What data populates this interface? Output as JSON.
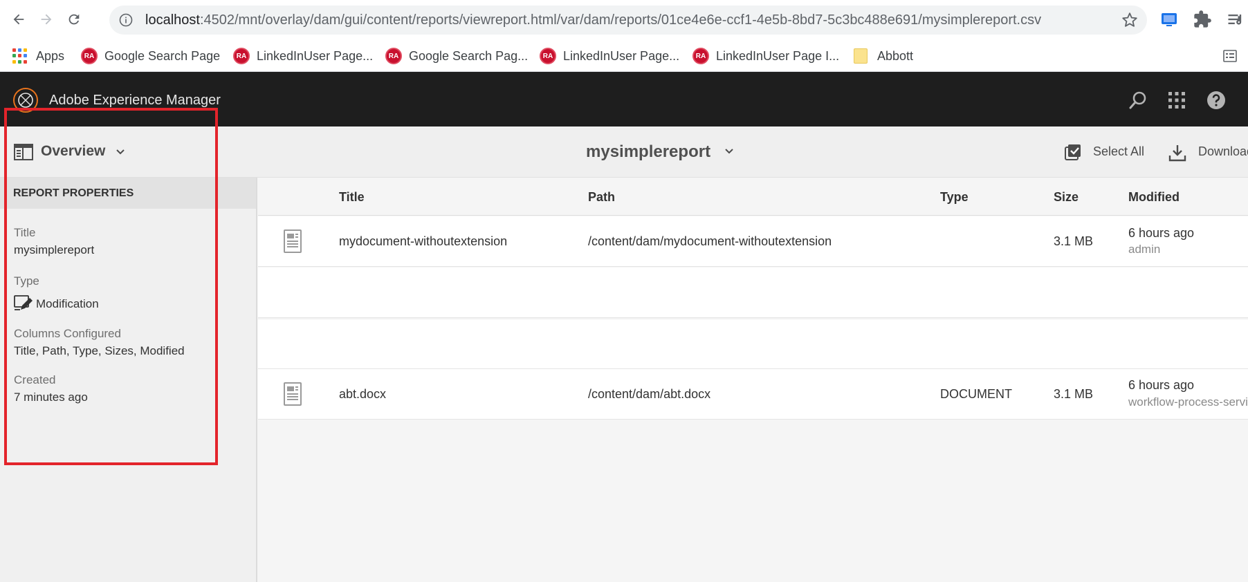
{
  "browser": {
    "url_host": "localhost",
    "url_path": ":4502/mnt/overlay/dam/gui/content/reports/viewreport.html/var/dam/reports/01ce4e6e-ccf1-4e5b-8bd7-5c3bc488e691/mysimplereport.csv",
    "bookmarks": [
      {
        "label": "Apps",
        "icon": "apps-grid-icon"
      },
      {
        "label": "Google Search Page",
        "icon": "ra-icon"
      },
      {
        "label": "LinkedInUser Page...",
        "icon": "ra-icon"
      },
      {
        "label": "Google Search Pag...",
        "icon": "ra-icon"
      },
      {
        "label": "LinkedInUser Page...",
        "icon": "ra-icon"
      },
      {
        "label": "LinkedInUser Page I...",
        "icon": "ra-icon"
      },
      {
        "label": "Abbott",
        "icon": "folder-icon"
      }
    ],
    "ra_badge": "RA"
  },
  "shell": {
    "title": "Adobe Experience Manager",
    "icons": [
      "search-icon",
      "apps-grid-icon",
      "help-icon"
    ]
  },
  "action_bar": {
    "rail_label": "Overview",
    "report_title": "mysimplereport",
    "select_all_label": "Select All",
    "download_label": "Download"
  },
  "rail": {
    "section_title": "REPORT PROPERTIES",
    "properties": [
      {
        "label": "Title",
        "value": "mysimplereport"
      },
      {
        "label": "Type",
        "value": "Modification",
        "icon": "edit-document-icon"
      },
      {
        "label": "Columns Configured",
        "value": "Title, Path, Type, Sizes, Modified"
      },
      {
        "label": "Created",
        "value": "7 minutes ago"
      }
    ]
  },
  "table": {
    "columns": [
      "Title",
      "Path",
      "Type",
      "Size",
      "Modified"
    ],
    "rows": [
      {
        "title": "mydocument-withoutextension",
        "path": "/content/dam/mydocument-withoutextension",
        "type": "",
        "size": "3.1 MB",
        "modified": "6 hours ago",
        "modified_by": "admin"
      },
      {
        "title": "abt.docx",
        "path": "/content/dam/abt.docx",
        "type": "DOCUMENT",
        "size": "3.1 MB",
        "modified": "6 hours ago",
        "modified_by": "workflow-process-service"
      }
    ]
  },
  "colors": {
    "shell_header": "#1e1e1e",
    "highlight": "#e3242b",
    "aem_logo_accent": "#e8731c"
  }
}
